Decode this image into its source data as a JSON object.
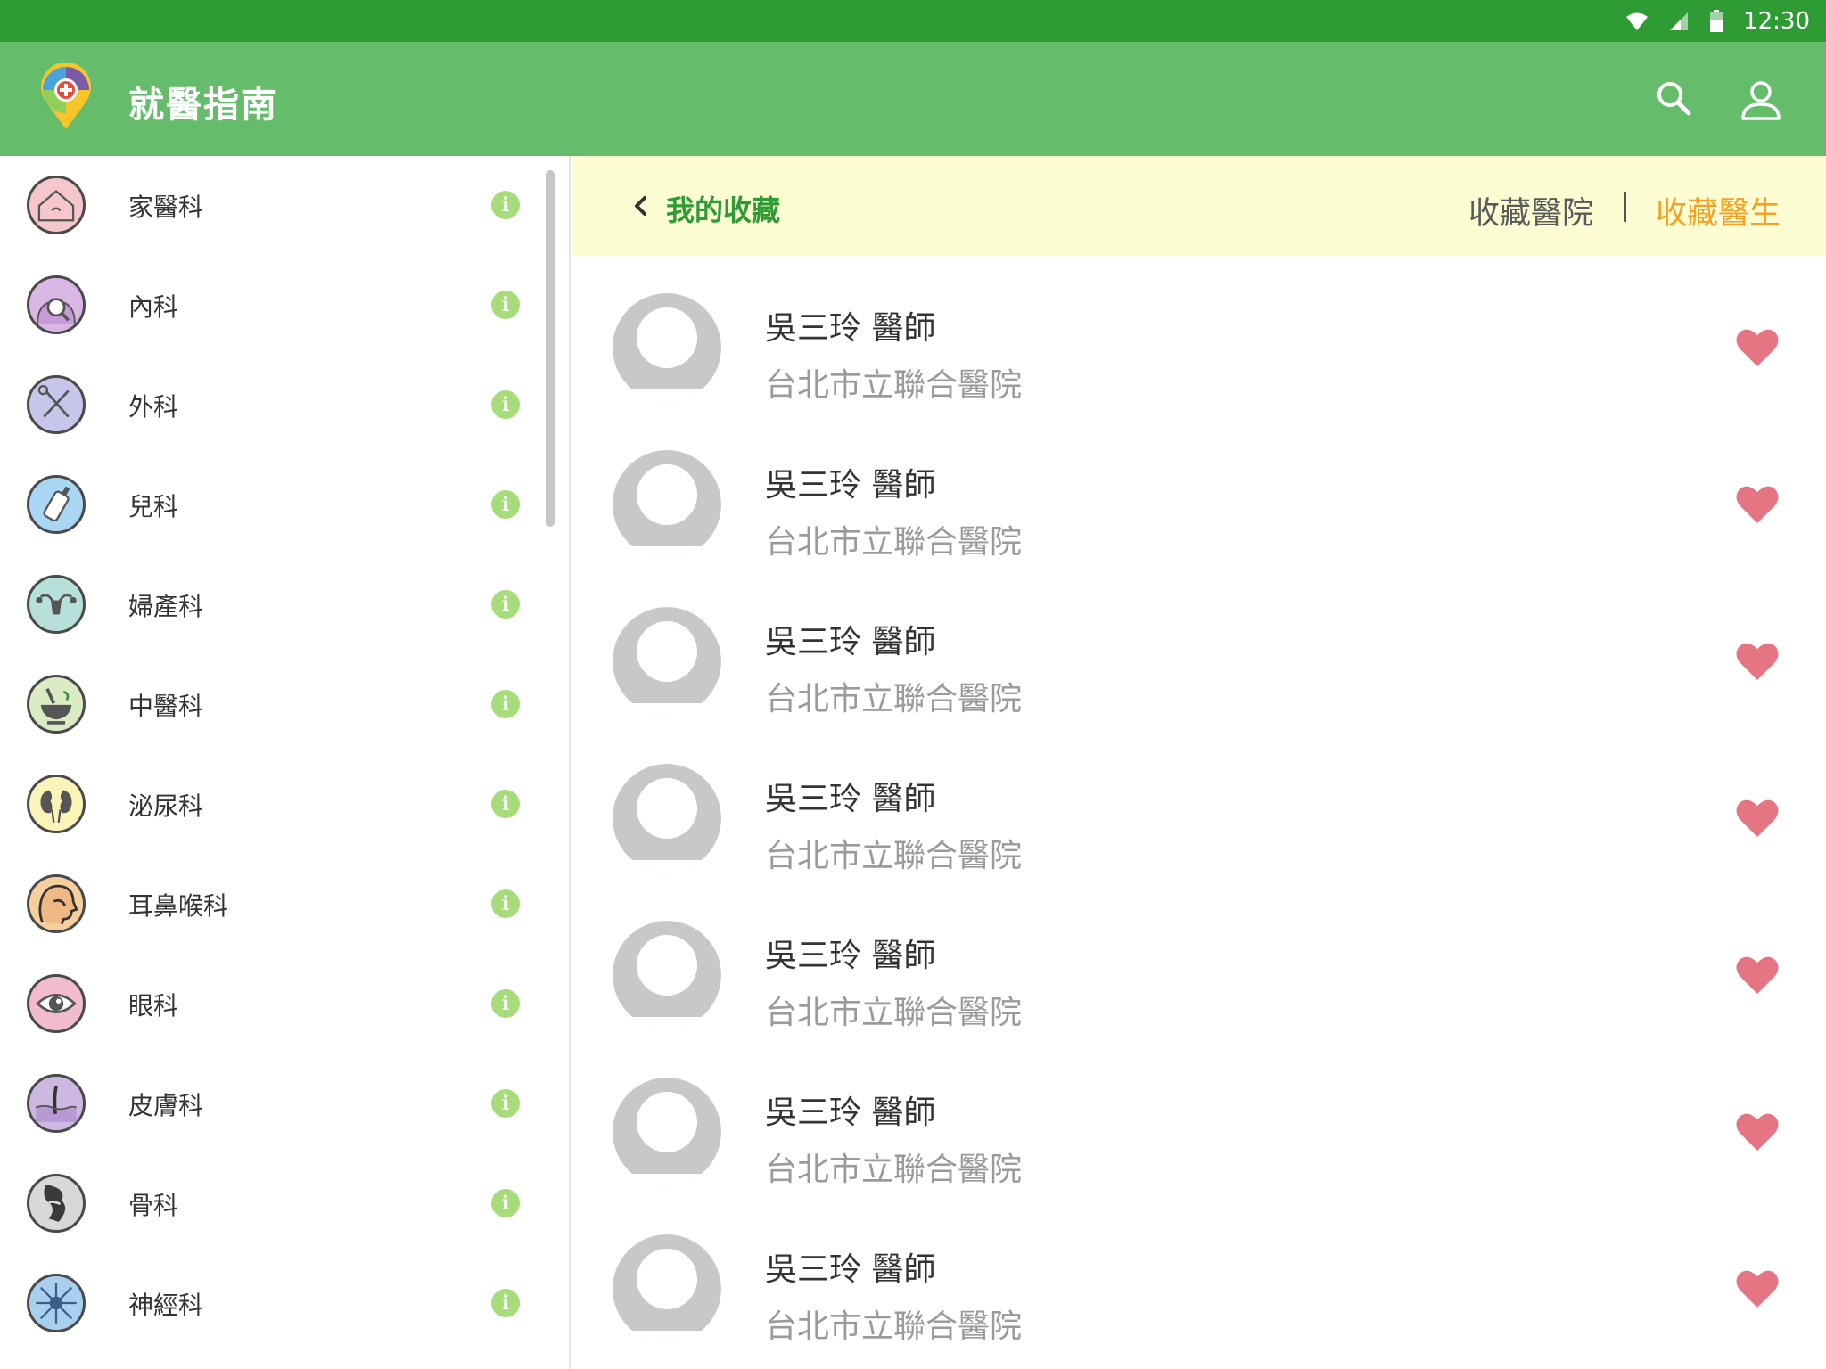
{
  "status_bar": {
    "time": "12:30"
  },
  "app_bar": {
    "title": "就醫指南"
  },
  "colors": {
    "status_bar": "#2e9b34",
    "app_bar": "#65bd6b",
    "subheader_bg": "#fcfcd2",
    "title_green": "#2e9b34",
    "active_tab": "#f6a022",
    "heart": "#e57583",
    "info": "#a6dd7a"
  },
  "sidebar": {
    "items": [
      {
        "label": "家醫科",
        "icon": "house-icon",
        "color": "#f5c7cc"
      },
      {
        "label": "內科",
        "icon": "magnifier-body-icon",
        "color": "#d9b6e4"
      },
      {
        "label": "外科",
        "icon": "scalpel-scissors-icon",
        "color": "#c7c6ea"
      },
      {
        "label": "兒科",
        "icon": "baby-bottle-icon",
        "color": "#a9d7f3"
      },
      {
        "label": "婦產科",
        "icon": "uterus-icon",
        "color": "#b8e0da"
      },
      {
        "label": "中醫科",
        "icon": "mortar-herb-icon",
        "color": "#d9ecc4"
      },
      {
        "label": "泌尿科",
        "icon": "kidney-icon",
        "color": "#fbf4b8"
      },
      {
        "label": "耳鼻喉科",
        "icon": "head-profile-icon",
        "color": "#f6cf9f"
      },
      {
        "label": "眼科",
        "icon": "eye-icon",
        "color": "#f3bccd"
      },
      {
        "label": "皮膚科",
        "icon": "skin-hair-icon",
        "color": "#cdb8e2"
      },
      {
        "label": "骨科",
        "icon": "bone-joint-icon",
        "color": "#d8d8d8"
      },
      {
        "label": "神經科",
        "icon": "neuron-icon",
        "color": "#a8cfee"
      }
    ]
  },
  "subheader": {
    "title": "我的收藏",
    "tab_hospitals": "收藏醫院",
    "tab_doctors": "收藏醫生",
    "active_tab": "收藏醫生"
  },
  "favorites": {
    "doctors": [
      {
        "name": "吳三玲 醫師",
        "hospital": "台北市立聯合醫院"
      },
      {
        "name": "吳三玲 醫師",
        "hospital": "台北市立聯合醫院"
      },
      {
        "name": "吳三玲 醫師",
        "hospital": "台北市立聯合醫院"
      },
      {
        "name": "吳三玲 醫師",
        "hospital": "台北市立聯合醫院"
      },
      {
        "name": "吳三玲 醫師",
        "hospital": "台北市立聯合醫院"
      },
      {
        "name": "吳三玲 醫師",
        "hospital": "台北市立聯合醫院"
      },
      {
        "name": "吳三玲 醫師",
        "hospital": "台北市立聯合醫院"
      }
    ]
  }
}
